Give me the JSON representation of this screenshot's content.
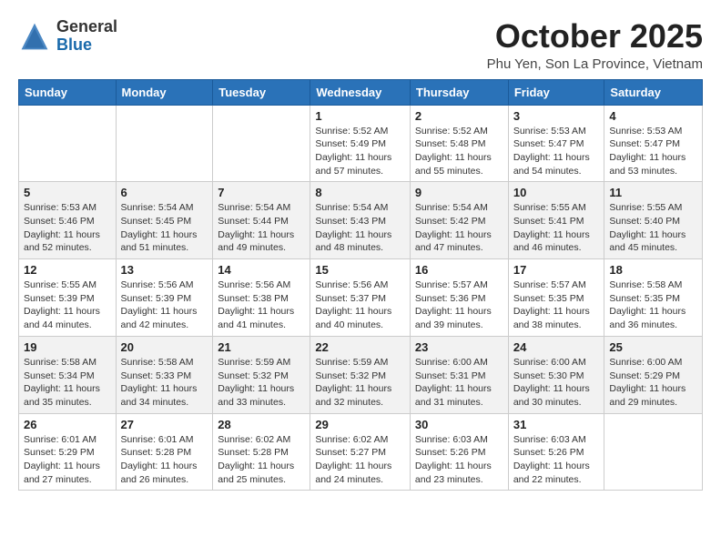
{
  "logo": {
    "general": "General",
    "blue": "Blue"
  },
  "header": {
    "month": "October 2025",
    "location": "Phu Yen, Son La Province, Vietnam"
  },
  "weekdays": [
    "Sunday",
    "Monday",
    "Tuesday",
    "Wednesday",
    "Thursday",
    "Friday",
    "Saturday"
  ],
  "weeks": [
    [
      {
        "day": "",
        "info": ""
      },
      {
        "day": "",
        "info": ""
      },
      {
        "day": "",
        "info": ""
      },
      {
        "day": "1",
        "info": "Sunrise: 5:52 AM\nSunset: 5:49 PM\nDaylight: 11 hours and 57 minutes."
      },
      {
        "day": "2",
        "info": "Sunrise: 5:52 AM\nSunset: 5:48 PM\nDaylight: 11 hours and 55 minutes."
      },
      {
        "day": "3",
        "info": "Sunrise: 5:53 AM\nSunset: 5:47 PM\nDaylight: 11 hours and 54 minutes."
      },
      {
        "day": "4",
        "info": "Sunrise: 5:53 AM\nSunset: 5:47 PM\nDaylight: 11 hours and 53 minutes."
      }
    ],
    [
      {
        "day": "5",
        "info": "Sunrise: 5:53 AM\nSunset: 5:46 PM\nDaylight: 11 hours and 52 minutes."
      },
      {
        "day": "6",
        "info": "Sunrise: 5:54 AM\nSunset: 5:45 PM\nDaylight: 11 hours and 51 minutes."
      },
      {
        "day": "7",
        "info": "Sunrise: 5:54 AM\nSunset: 5:44 PM\nDaylight: 11 hours and 49 minutes."
      },
      {
        "day": "8",
        "info": "Sunrise: 5:54 AM\nSunset: 5:43 PM\nDaylight: 11 hours and 48 minutes."
      },
      {
        "day": "9",
        "info": "Sunrise: 5:54 AM\nSunset: 5:42 PM\nDaylight: 11 hours and 47 minutes."
      },
      {
        "day": "10",
        "info": "Sunrise: 5:55 AM\nSunset: 5:41 PM\nDaylight: 11 hours and 46 minutes."
      },
      {
        "day": "11",
        "info": "Sunrise: 5:55 AM\nSunset: 5:40 PM\nDaylight: 11 hours and 45 minutes."
      }
    ],
    [
      {
        "day": "12",
        "info": "Sunrise: 5:55 AM\nSunset: 5:39 PM\nDaylight: 11 hours and 44 minutes."
      },
      {
        "day": "13",
        "info": "Sunrise: 5:56 AM\nSunset: 5:39 PM\nDaylight: 11 hours and 42 minutes."
      },
      {
        "day": "14",
        "info": "Sunrise: 5:56 AM\nSunset: 5:38 PM\nDaylight: 11 hours and 41 minutes."
      },
      {
        "day": "15",
        "info": "Sunrise: 5:56 AM\nSunset: 5:37 PM\nDaylight: 11 hours and 40 minutes."
      },
      {
        "day": "16",
        "info": "Sunrise: 5:57 AM\nSunset: 5:36 PM\nDaylight: 11 hours and 39 minutes."
      },
      {
        "day": "17",
        "info": "Sunrise: 5:57 AM\nSunset: 5:35 PM\nDaylight: 11 hours and 38 minutes."
      },
      {
        "day": "18",
        "info": "Sunrise: 5:58 AM\nSunset: 5:35 PM\nDaylight: 11 hours and 36 minutes."
      }
    ],
    [
      {
        "day": "19",
        "info": "Sunrise: 5:58 AM\nSunset: 5:34 PM\nDaylight: 11 hours and 35 minutes."
      },
      {
        "day": "20",
        "info": "Sunrise: 5:58 AM\nSunset: 5:33 PM\nDaylight: 11 hours and 34 minutes."
      },
      {
        "day": "21",
        "info": "Sunrise: 5:59 AM\nSunset: 5:32 PM\nDaylight: 11 hours and 33 minutes."
      },
      {
        "day": "22",
        "info": "Sunrise: 5:59 AM\nSunset: 5:32 PM\nDaylight: 11 hours and 32 minutes."
      },
      {
        "day": "23",
        "info": "Sunrise: 6:00 AM\nSunset: 5:31 PM\nDaylight: 11 hours and 31 minutes."
      },
      {
        "day": "24",
        "info": "Sunrise: 6:00 AM\nSunset: 5:30 PM\nDaylight: 11 hours and 30 minutes."
      },
      {
        "day": "25",
        "info": "Sunrise: 6:00 AM\nSunset: 5:29 PM\nDaylight: 11 hours and 29 minutes."
      }
    ],
    [
      {
        "day": "26",
        "info": "Sunrise: 6:01 AM\nSunset: 5:29 PM\nDaylight: 11 hours and 27 minutes."
      },
      {
        "day": "27",
        "info": "Sunrise: 6:01 AM\nSunset: 5:28 PM\nDaylight: 11 hours and 26 minutes."
      },
      {
        "day": "28",
        "info": "Sunrise: 6:02 AM\nSunset: 5:28 PM\nDaylight: 11 hours and 25 minutes."
      },
      {
        "day": "29",
        "info": "Sunrise: 6:02 AM\nSunset: 5:27 PM\nDaylight: 11 hours and 24 minutes."
      },
      {
        "day": "30",
        "info": "Sunrise: 6:03 AM\nSunset: 5:26 PM\nDaylight: 11 hours and 23 minutes."
      },
      {
        "day": "31",
        "info": "Sunrise: 6:03 AM\nSunset: 5:26 PM\nDaylight: 11 hours and 22 minutes."
      },
      {
        "day": "",
        "info": ""
      }
    ]
  ]
}
